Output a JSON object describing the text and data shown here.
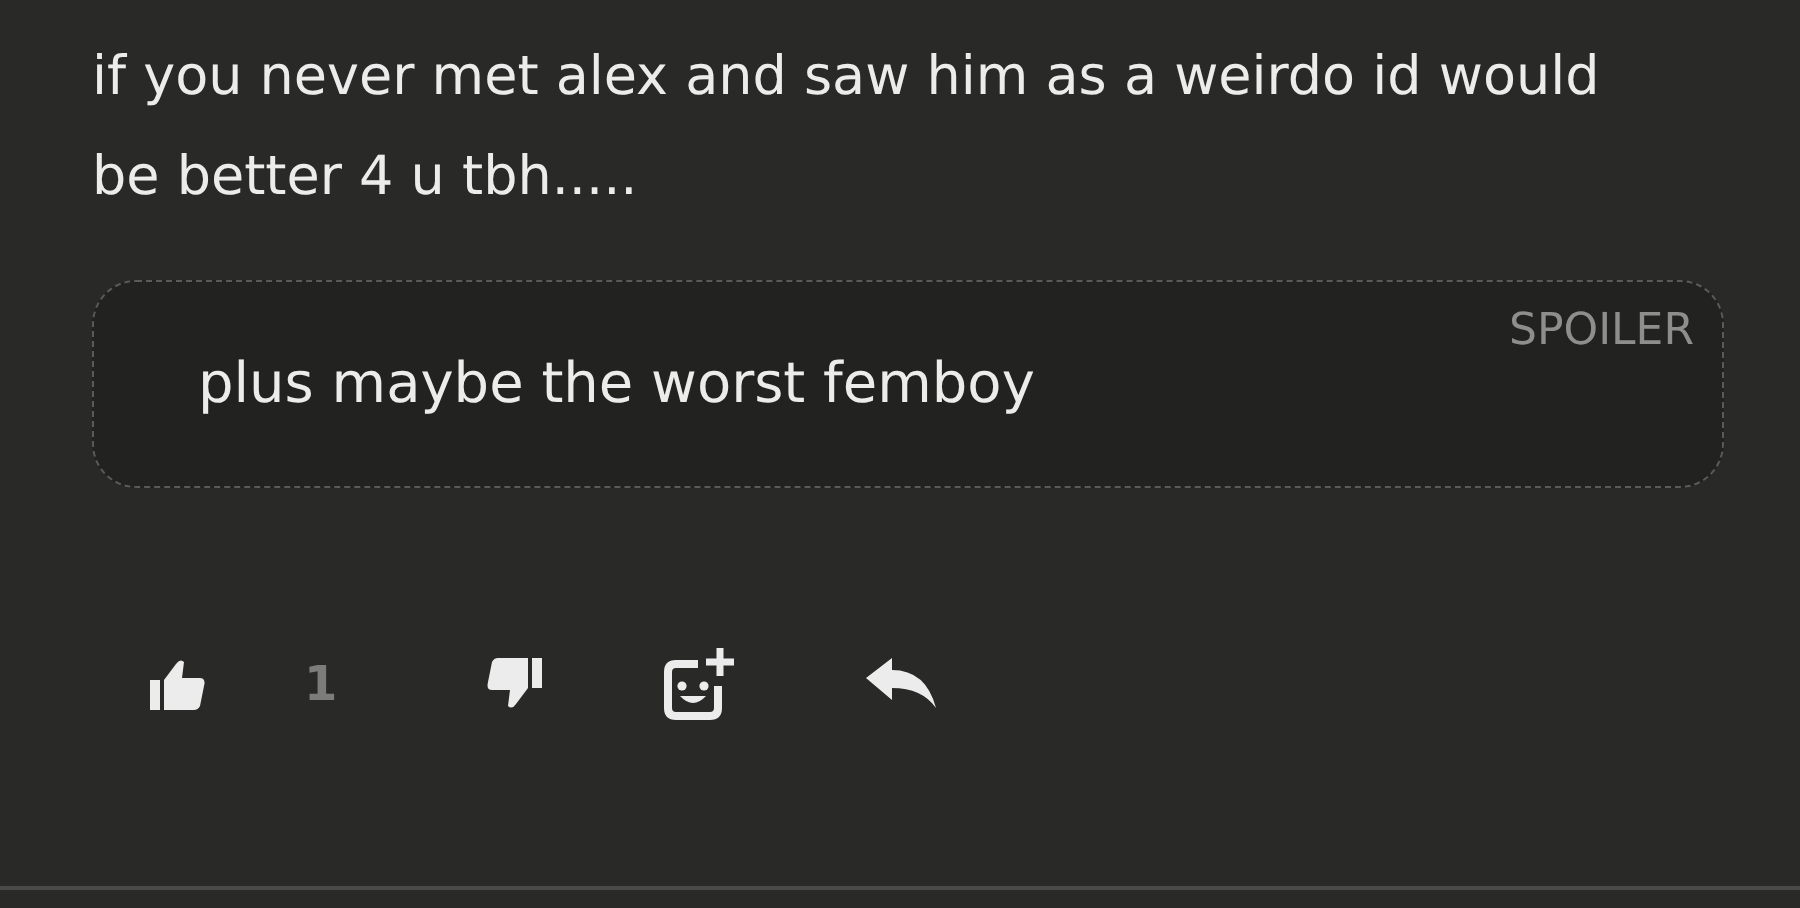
{
  "comment": {
    "text": "if you never met alex and saw him as a weirdo id would be better 4 u tbh.....",
    "spoiler": {
      "label": "SPOILER",
      "text": "plus maybe the worst femboy"
    }
  },
  "actions": {
    "like_count": "1"
  }
}
